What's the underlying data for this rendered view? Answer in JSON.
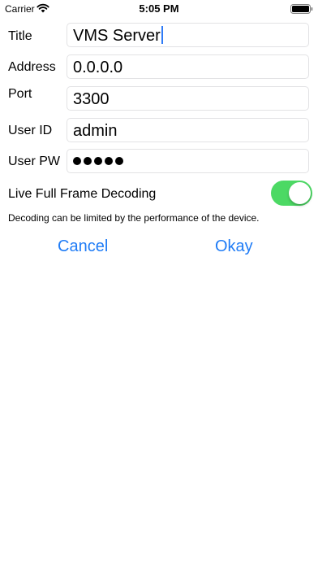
{
  "status_bar": {
    "carrier": "Carrier",
    "time": "5:05 PM",
    "icons": [
      "wifi-icon",
      "battery-icon"
    ]
  },
  "form": {
    "title": {
      "label": "Title",
      "value": "VMS Server"
    },
    "address": {
      "label": "Address",
      "value": "0.0.0.0"
    },
    "port": {
      "label": "Port",
      "value": "3300"
    },
    "user_id": {
      "label": "User ID",
      "value": "admin"
    },
    "user_pw": {
      "label": "User PW",
      "masked_length": 5
    }
  },
  "decoding": {
    "label": "Live Full Frame Decoding",
    "enabled": true,
    "note": "Decoding can be limited by the performance of the device."
  },
  "actions": {
    "cancel": "Cancel",
    "okay": "Okay"
  },
  "colors": {
    "accent": "#1f7cf6",
    "toggle_on": "#4cd964",
    "field_border": "#e2e2e4",
    "caret": "#2f7bf6"
  }
}
